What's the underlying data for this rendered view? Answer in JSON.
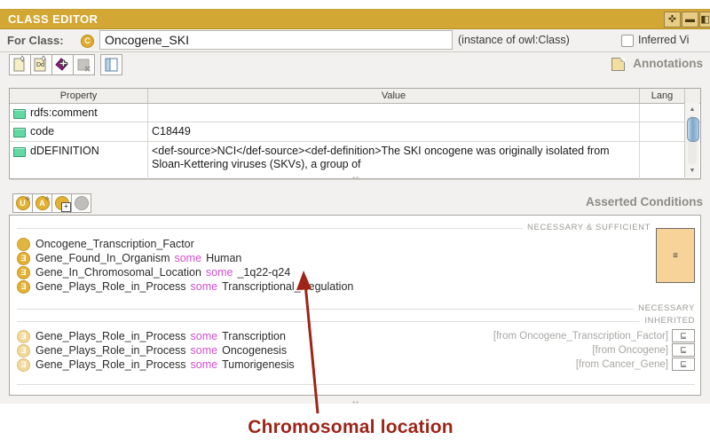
{
  "window": {
    "title": "CLASS EDITOR",
    "controls": [
      {
        "name": "maximize-icon",
        "glyph": "✜"
      },
      {
        "name": "minimize-icon",
        "glyph": "▬"
      },
      {
        "name": "float-icon",
        "glyph": "◧"
      }
    ]
  },
  "for_class": {
    "label": "For Class:",
    "badge_glyph": "C",
    "value": "Oncogene_SKI",
    "instance_of": "(instance of owl:Class)",
    "inferred_label": "Inferred Vi"
  },
  "annotations": {
    "panel_label": "Annotations",
    "toolbar": [
      {
        "name": "create-annotation-button",
        "glyph": "▤"
      },
      {
        "name": "create-datatype-annotation-button",
        "glyph": "Dt"
      },
      {
        "name": "add-annotation-button",
        "glyph": "◆"
      },
      {
        "name": "remove-annotation-button",
        "glyph": "▦"
      },
      {
        "name": "toggle-annotation-view-button",
        "glyph": "▥"
      }
    ],
    "columns": [
      "Property",
      "Value",
      "Lang"
    ],
    "rows": [
      {
        "property": "rdfs:comment",
        "value": "",
        "lang": ""
      },
      {
        "property": "code",
        "value": "C18449",
        "lang": ""
      },
      {
        "property": "dDEFINITION",
        "value": "<def-source>NCI</def-source><def-definition>The SKI oncogene was originally isolated from Sloan-Kettering viruses (SKVs), a group of",
        "lang": ""
      }
    ],
    "scroll": {
      "up": "▲",
      "down": "▼"
    }
  },
  "conditions": {
    "panel_label": "Asserted Conditions",
    "toolbar": [
      {
        "name": "create-necessary-sufficient-condition-button",
        "glyph": "U"
      },
      {
        "name": "create-necessary-condition-button",
        "glyph": "A"
      },
      {
        "name": "add-condition-button",
        "glyph": ""
      },
      {
        "name": "remove-condition-button",
        "glyph": ""
      }
    ],
    "sections": [
      {
        "header": "NECESSARY & SUFFICIENT"
      },
      {
        "header": "NECESSARY"
      },
      {
        "header": "INHERITED"
      }
    ],
    "necessary_sufficient": [
      {
        "icon": "class-circle-icon",
        "prefix": "Oncogene_Transcription_Factor",
        "keyword": "",
        "filler": ""
      },
      {
        "icon": "existential-restriction-icon",
        "prefix": "Gene_Found_In_Organism",
        "keyword": "some",
        "filler": "Human"
      },
      {
        "icon": "existential-restriction-icon",
        "prefix": "Gene_In_Chromosomal_Location",
        "keyword": "some",
        "filler": "_1q22-q24"
      },
      {
        "icon": "existential-restriction-icon",
        "prefix": "Gene_Plays_Role_in_Process",
        "keyword": "some",
        "filler": "Transcriptional_Regulation"
      }
    ],
    "inherited": [
      {
        "icon": "existential-restriction-icon",
        "prefix": "Gene_Plays_Role_in_Process",
        "keyword": "some",
        "filler": "Transcription",
        "from": "[from Oncogene_Transcription_Factor]",
        "button": "⊑"
      },
      {
        "icon": "existential-restriction-icon",
        "prefix": "Gene_Plays_Role_in_Process",
        "keyword": "some",
        "filler": "Oncogenesis",
        "from": "[from Oncogene]",
        "button": "⊑"
      },
      {
        "icon": "existential-restriction-icon",
        "prefix": "Gene_Plays_Role_in_Process",
        "keyword": "some",
        "filler": "Tumorigenesis",
        "from": "[from Cancer_Gene]",
        "button": "⊑"
      }
    ],
    "side_widget_glyph": "≡"
  },
  "annotation_overlay": {
    "caption": "Chromosomal location",
    "color": "#9e2418"
  },
  "splitter_glyph": "▪▪"
}
